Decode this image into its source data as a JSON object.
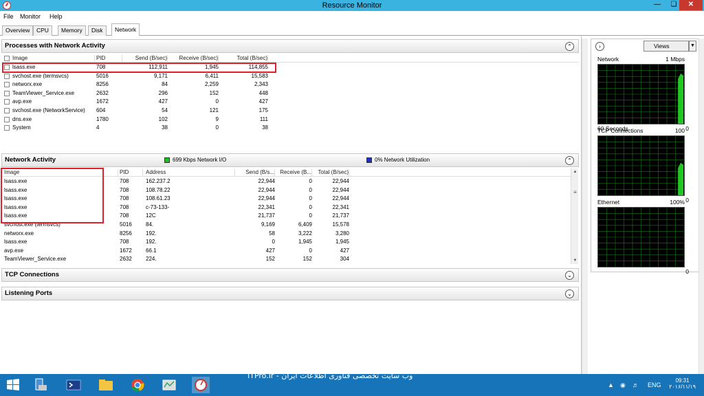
{
  "window": {
    "title": "Resource Monitor"
  },
  "menu": [
    "File",
    "Monitor",
    "Help"
  ],
  "tabs": [
    "Overview",
    "CPU",
    "Memory",
    "Disk",
    "Network"
  ],
  "proc_section": {
    "title": "Processes with Network Activity",
    "columns": [
      "Image",
      "PID",
      "Send (B/sec)",
      "Receive (B/sec)",
      "Total (B/sec)"
    ],
    "rows": [
      [
        "lsass.exe",
        "708",
        "112,911",
        "1,945",
        "114,855"
      ],
      [
        "svchost.exe (termsvcs)",
        "5016",
        "9,171",
        "6,411",
        "15,583"
      ],
      [
        "networx.exe",
        "8256",
        "84",
        "2,259",
        "2,343"
      ],
      [
        "TeamViewer_Service.exe",
        "2632",
        "296",
        "152",
        "448"
      ],
      [
        "avp.exe",
        "1672",
        "427",
        "0",
        "427"
      ],
      [
        "svchost.exe (NetworkService)",
        "604",
        "54",
        "121",
        "175"
      ],
      [
        "dns.exe",
        "1780",
        "102",
        "9",
        "111"
      ],
      [
        "System",
        "4",
        "38",
        "0",
        "38"
      ]
    ]
  },
  "net_section": {
    "title": "Network Activity",
    "io_label": "699 Kbps Network I/O",
    "util_label": "0% Network Utilization",
    "io_color": "#1fbf1f",
    "util_color": "#1f2fbf",
    "columns": [
      "Image",
      "PID",
      "Address",
      "Send (B/s...",
      "Receive (B...",
      "Total (B/sec)"
    ],
    "rows": [
      [
        "lsass.exe",
        "708",
        "162.237.2",
        "22,944",
        "0",
        "22,944"
      ],
      [
        "lsass.exe",
        "708",
        "108.78.22",
        "22,944",
        "0",
        "22,944"
      ],
      [
        "lsass.exe",
        "708",
        "108.61.23",
        "22,944",
        "0",
        "22,944"
      ],
      [
        "lsass.exe",
        "708",
        "c-73-133-",
        "22,341",
        "0",
        "22,341"
      ],
      [
        "lsass.exe",
        "708",
        "12C",
        "21,737",
        "0",
        "21,737"
      ],
      [
        "svchost.exe (termsvcs)",
        "5016",
        "84.",
        "9,169",
        "6,409",
        "15,578"
      ],
      [
        "networx.exe",
        "8256",
        "192.",
        "58",
        "3,222",
        "3,280"
      ],
      [
        "lsass.exe",
        "708",
        "192.",
        "0",
        "1,945",
        "1,945"
      ],
      [
        "avp.exe",
        "1672",
        "66.1",
        "427",
        "0",
        "427"
      ],
      [
        "TeamViewer_Service.exe",
        "2632",
        "224.",
        "152",
        "152",
        "304"
      ]
    ]
  },
  "tcp_section": {
    "title": "TCP Connections"
  },
  "ports_section": {
    "title": "Listening Ports"
  },
  "right_pane": {
    "views_label": "Views",
    "graphs": [
      {
        "label": "Network",
        "max": "1 Mbps",
        "footer_left": "60 Seconds",
        "footer_right": "0",
        "level": 0.85
      },
      {
        "label": "TCP Connections",
        "max": "100",
        "footer_left": "",
        "footer_right": "0",
        "level": 0.55
      },
      {
        "label": "Ethernet",
        "max": "100%",
        "footer_left": "",
        "footer_right": "0",
        "level": 0.0
      }
    ]
  },
  "taskbar": {
    "watermark": "ITPro.ir - وب سایت تخصصی فناوری اطلاعات ایران",
    "lang": "ENG",
    "time": "09:31",
    "date": "۲۰۱۶/۱۱/۱۹"
  }
}
